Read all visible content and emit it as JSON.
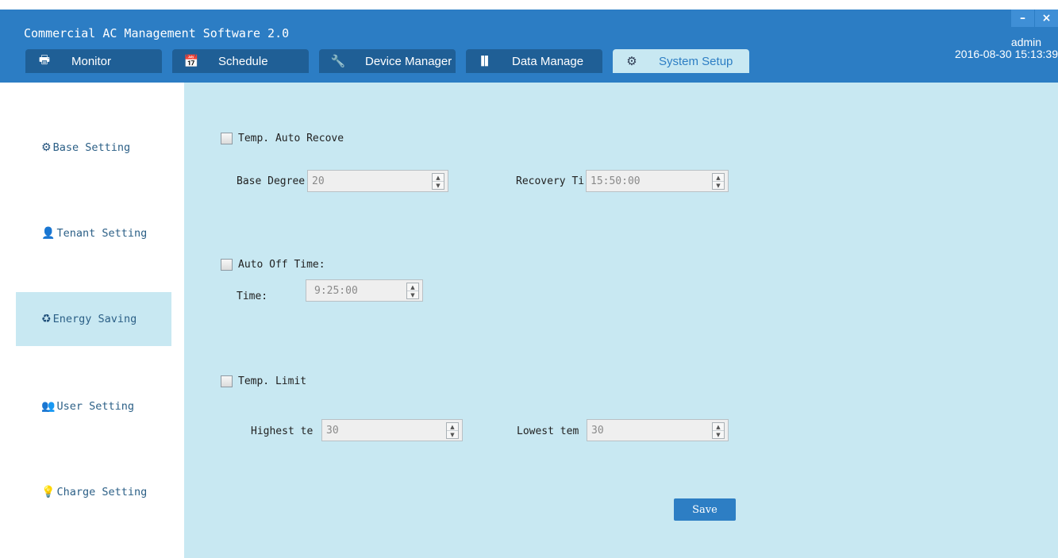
{
  "app": {
    "title": "Commercial AC Management Software 2.0"
  },
  "window_controls": {
    "minimize": "–",
    "close": "×"
  },
  "tabs": [
    {
      "label": "Monitor",
      "icon": "printer-icon",
      "glyph": "🖶"
    },
    {
      "label": "Schedule",
      "icon": "calendar-icon",
      "glyph": "📅"
    },
    {
      "label": "Device Manager",
      "icon": "wrench-icon",
      "glyph": "🔧"
    },
    {
      "label": "Data Manage",
      "icon": "bar-chart-icon",
      "glyph": "▌▌"
    },
    {
      "label": "System Setup",
      "icon": "gear-icon",
      "glyph": "⚙"
    }
  ],
  "active_tab": "System Setup",
  "user": {
    "name": "admin",
    "datetime": "2016-08-30 15:13:39"
  },
  "sidebar": {
    "items": [
      {
        "label": "Base Setting",
        "icon": "gear-icon",
        "glyph": "⚙"
      },
      {
        "label": "Tenant Setting",
        "icon": "person-icon",
        "glyph": "👤"
      },
      {
        "label": "Energy Saving",
        "icon": "recycle-icon",
        "glyph": "♻"
      },
      {
        "label": "User Setting",
        "icon": "users-icon",
        "glyph": "👥"
      },
      {
        "label": "Charge Setting",
        "icon": "lightbulb-icon",
        "glyph": "💡"
      }
    ],
    "active": "Energy Saving"
  },
  "form": {
    "temp_auto_recover": {
      "label": "Temp. Auto Recove",
      "checked": false,
      "base_degree_label": "Base Degree",
      "base_degree_value": "20",
      "recovery_time_label": "Recovery Ti",
      "recovery_time_value": "15:50:00"
    },
    "auto_off_time": {
      "label": "Auto Off Time:",
      "checked": false,
      "time_label": "Time:",
      "time_value": "9:25:00"
    },
    "temp_limit": {
      "label": "Temp. Limit",
      "checked": false,
      "highest_label": "Highest te",
      "highest_value": "30",
      "lowest_label": "Lowest tem",
      "lowest_value": "30"
    },
    "save_label": "Save"
  },
  "colors": {
    "header": "#2c7dc4",
    "tab": "#1f5f96",
    "panel": "#c8e8f2",
    "accent": "#2d7ec4"
  }
}
